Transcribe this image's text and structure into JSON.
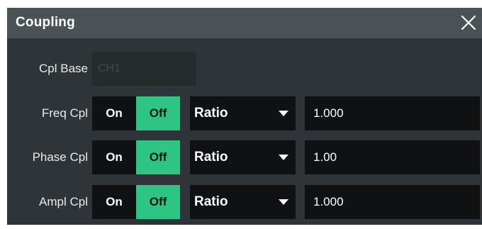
{
  "dialog": {
    "title": "Coupling",
    "close_icon": "close-icon"
  },
  "cpl_base": {
    "label": "Cpl Base",
    "value": "CH1"
  },
  "rows": [
    {
      "label": "Freq Cpl",
      "on": "On",
      "off": "Off",
      "state": "Off",
      "mode": "Ratio",
      "value": "1.000"
    },
    {
      "label": "Phase Cpl",
      "on": "On",
      "off": "Off",
      "state": "Off",
      "mode": "Ratio",
      "value": "1.00"
    },
    {
      "label": "Ampl Cpl",
      "on": "On",
      "off": "Off",
      "state": "Off",
      "mode": "Ratio",
      "value": "1.000"
    }
  ],
  "colors": {
    "accent": "#2ec484",
    "dialog_bg": "#2e3438",
    "titlebar_bg": "#4b5255",
    "control_bg": "#0f1112"
  },
  "icons": {
    "dropdown": "caret-down-icon",
    "close": "close-icon"
  }
}
